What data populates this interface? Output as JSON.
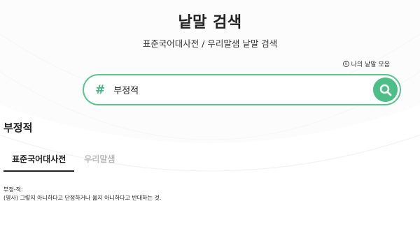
{
  "header": {
    "title": "낱말 검색",
    "subtitle": "표준국어대사전 / 우리말샘 낱말 검색",
    "my_words_link": "나의 낱말 모음"
  },
  "search": {
    "prefix_symbol": "#",
    "query": "부정적"
  },
  "result": {
    "heading": "부정적",
    "tabs": [
      {
        "label": "표준국어대사전",
        "active": true
      },
      {
        "label": "우리말샘",
        "active": false
      }
    ],
    "entry_word": "부정-적:",
    "definition": "(명사) 그렇지 아니하다고 단정하거나 옳지 아니하다고 반대하는 것."
  },
  "colors": {
    "accent": "#4bbf85",
    "accent_border": "#5cc58e"
  },
  "icons": {
    "search_button": "search-icon",
    "info": "info-icon"
  }
}
